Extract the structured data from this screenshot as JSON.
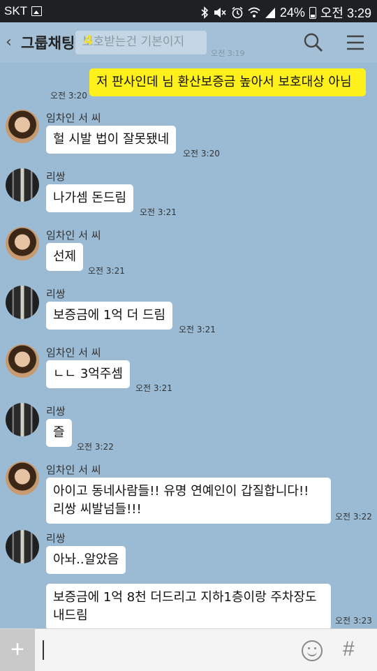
{
  "status_bar": {
    "carrier": "SKT",
    "battery": "24%",
    "time": "오전 3:29"
  },
  "header": {
    "title": "그룹채팅",
    "member_count": "4",
    "ghost_text": "보호받는건 기본이지",
    "ghost_time": "오전 3:19"
  },
  "messages": [
    {
      "type": "me",
      "text": "저 판사인데 님 환산보증금 높아서 보호대상 아님",
      "time": "오전 3:20"
    },
    {
      "sender": "임차인 서 씨",
      "text": "헐 시발 법이 잘못됐네",
      "time": "오전 3:20"
    },
    {
      "sender": "리쌍",
      "text": "나가셈 돈드림",
      "time": "오전 3:21"
    },
    {
      "sender": "임차인 서 씨",
      "text": "선제",
      "time": "오전 3:21"
    },
    {
      "sender": "리쌍",
      "text": "보증금에 1억 더 드림",
      "time": "오전 3:21"
    },
    {
      "sender": "임차인 서 씨",
      "text": "ㄴㄴ 3억주셈",
      "time": "오전 3:21"
    },
    {
      "sender": "리쌍",
      "text": "즐",
      "time": "오전 3:22"
    },
    {
      "sender": "임차인 서 씨",
      "text_line1": "아이고 동네사람들!! 유명 연예인이 갑질합니다!!",
      "text_line2": "리쌍 씨발넘들!!!",
      "time": "오전 3:22"
    },
    {
      "sender": "리쌍",
      "text": "아놔..알았음",
      "text2_line1": "보증금에 1억 8천 더드리고 지하1층이랑 주차장도",
      "text2_line2": "내드림",
      "time": "오전 3:23"
    }
  ],
  "input_bar": {
    "plus_label": "+",
    "hash_label": "#"
  },
  "colors": {
    "chat_background": "#9bbbd4",
    "my_bubble": "#fef01b",
    "other_bubble": "#ffffff",
    "member_count": "#f4e21c"
  },
  "icons": [
    "back-arrow-icon",
    "search-icon",
    "menu-icon",
    "gallery-icon",
    "bluetooth-icon",
    "mute-icon",
    "alarm-icon",
    "wifi-icon",
    "signal-icon",
    "battery-icon",
    "emoticon-icon",
    "hash-icon"
  ]
}
